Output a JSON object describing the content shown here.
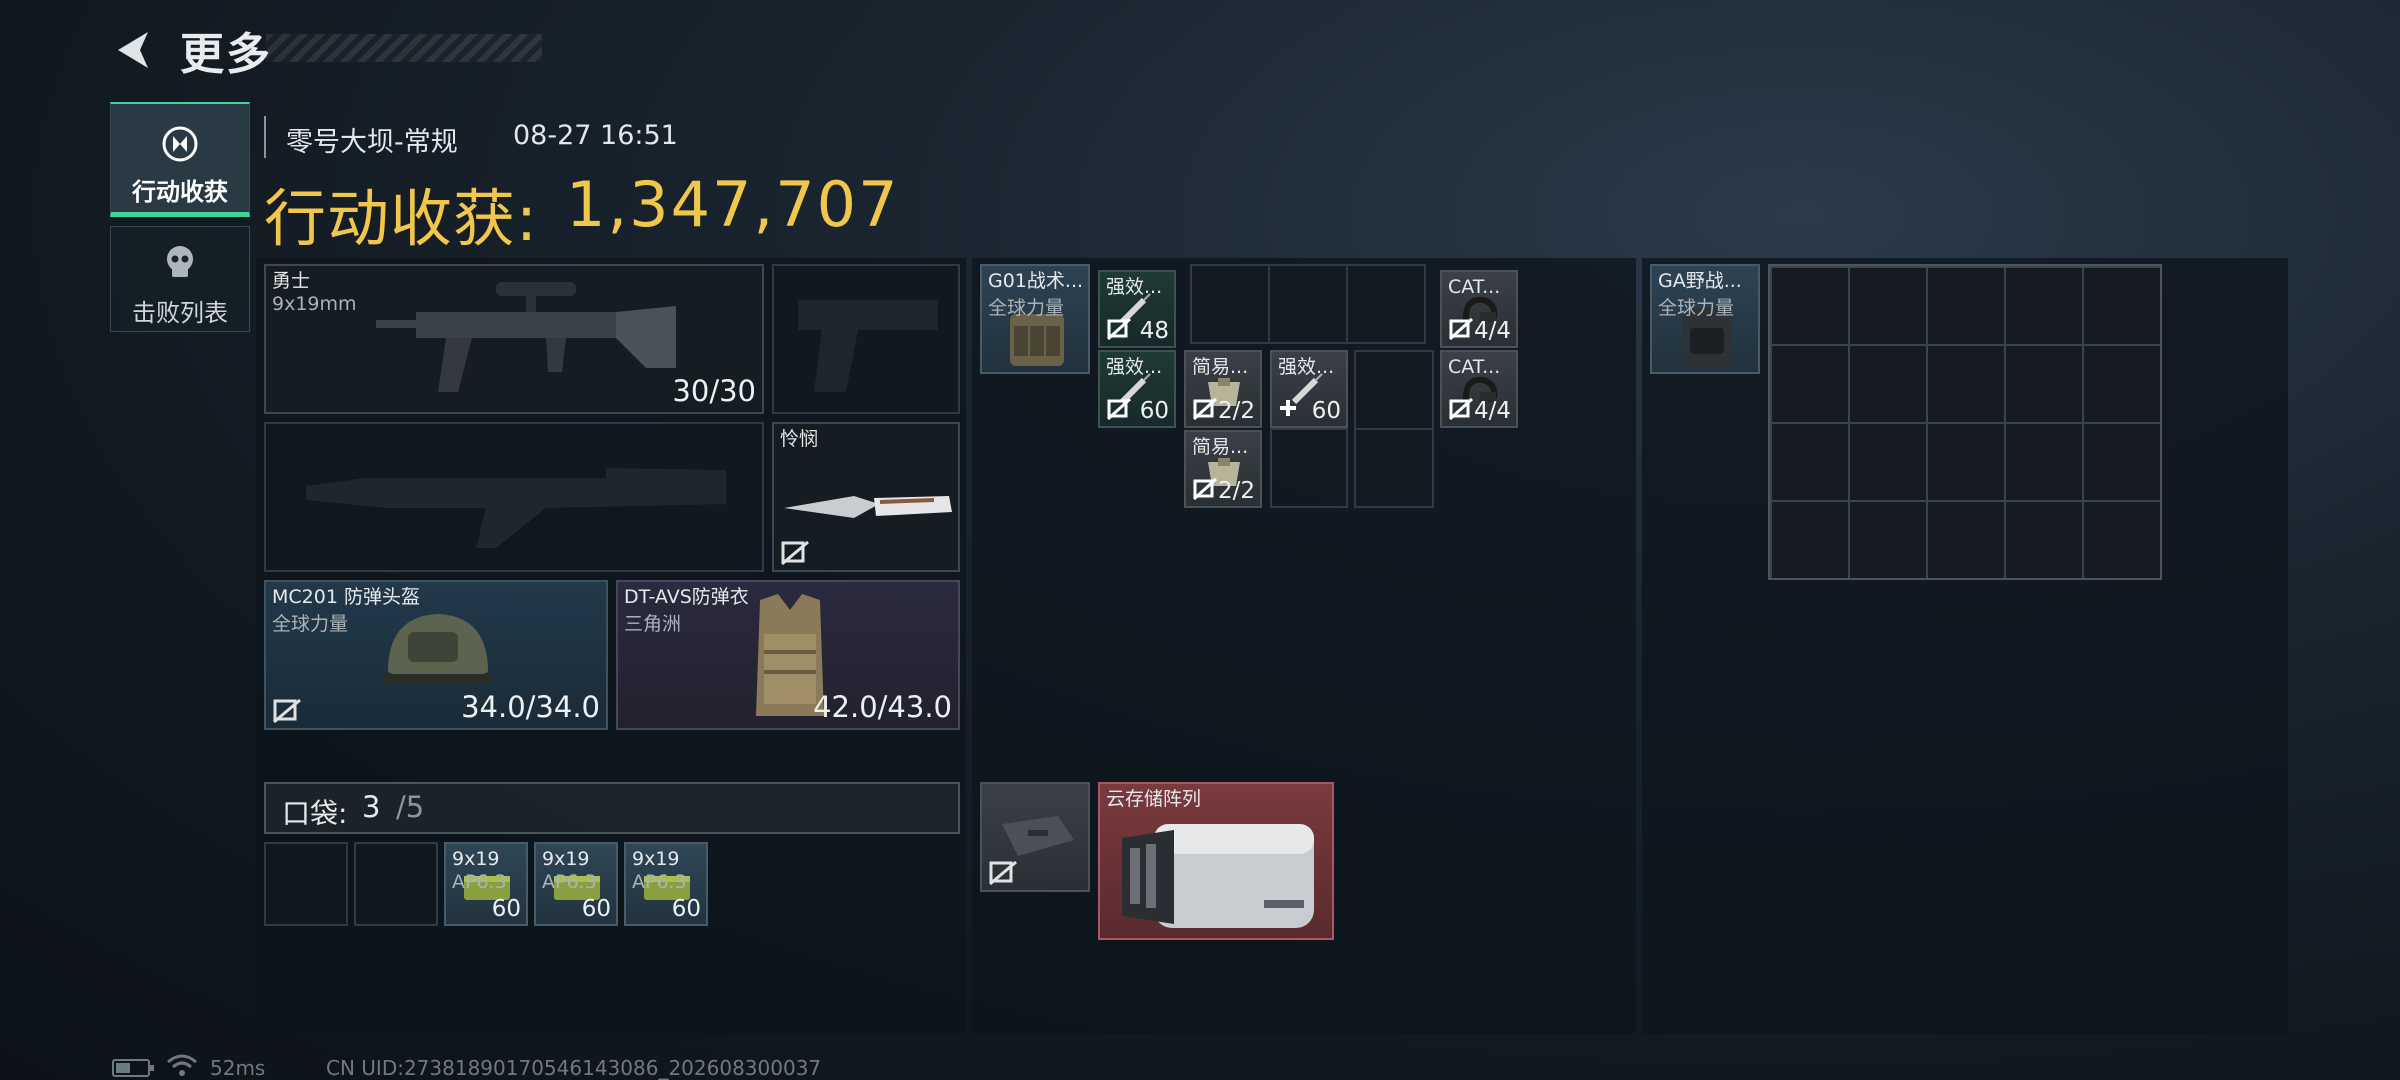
{
  "header": {
    "title": "更多"
  },
  "sidebar": {
    "tabs": [
      {
        "label": "行动收获",
        "icon": "raid-emblem-icon"
      },
      {
        "label": "击败列表",
        "icon": "skull-icon"
      }
    ]
  },
  "map": {
    "name": "零号大坝-常规",
    "time": "08-27 16:51"
  },
  "yield": {
    "label": "行动收获:",
    "value": "1,347,707"
  },
  "loadout": {
    "primary": {
      "name": "勇士",
      "caliber": "9x19mm",
      "ammo": "30/30"
    },
    "melee": {
      "name": "怜悯"
    },
    "helmet": {
      "name": "MC201 防弹头盔",
      "brand": "全球力量",
      "durability": "34.0/34.0"
    },
    "armor": {
      "name": "DT-AVS防弹衣",
      "brand": "三角洲",
      "durability": "42.0/43.0"
    }
  },
  "pockets": {
    "label": "口袋:",
    "used": "3",
    "capacity": "/5",
    "items": [
      {
        "name": "9x19",
        "sub": "AP6.3",
        "count": "60"
      },
      {
        "name": "9x19",
        "sub": "AP6.3",
        "count": "60"
      },
      {
        "name": "9x19",
        "sub": "AP6.3",
        "count": "60"
      }
    ]
  },
  "rig": {
    "name": "G01战术...",
    "brand": "全球力量",
    "items": [
      {
        "name": "强效...",
        "count": "48"
      },
      {
        "name": "强效...",
        "count": "60"
      },
      {
        "name": "简易...",
        "count": "2/2"
      },
      {
        "name": "强效...",
        "count": "60"
      },
      {
        "name": "简易...",
        "count": "2/2"
      },
      {
        "name": "CAT...",
        "count": "4/4"
      },
      {
        "name": "CAT...",
        "count": "4/4"
      }
    ]
  },
  "secure": {
    "name": "云存储阵列"
  },
  "backpack": {
    "name": "GA野战...",
    "brand": "全球力量"
  },
  "status": {
    "ping": "52ms",
    "uid": "CN UID:27381890170546143086_202608300037"
  }
}
